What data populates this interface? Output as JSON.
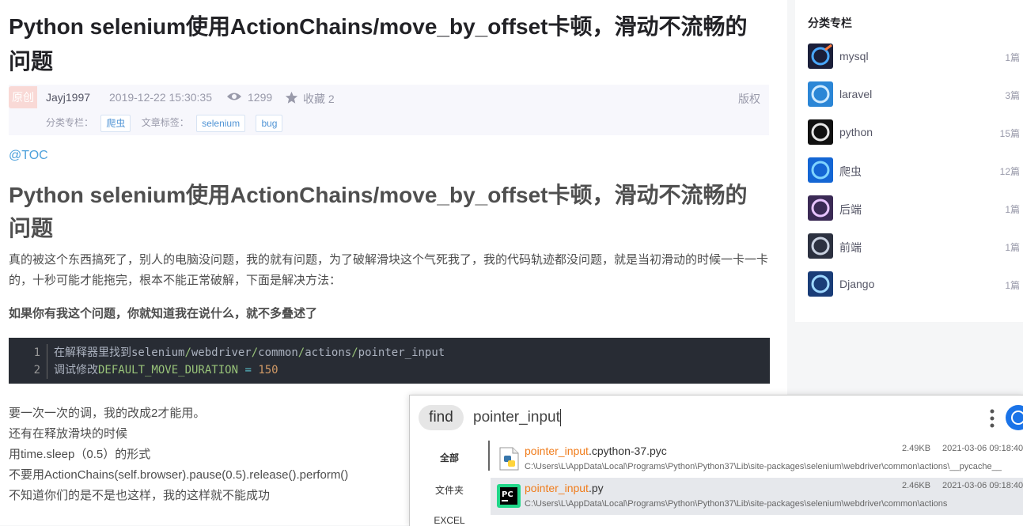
{
  "article": {
    "title": "Python selenium使用ActionChains/move_by_offset卡顿，滑动不流畅的问题",
    "badge": "原创",
    "author": "Jayj1997",
    "date": "2019-12-22 15:30:35",
    "views": "1299",
    "collect": "收藏 2",
    "copyright": "版权",
    "category_label": "分类专栏：",
    "category_tag": "爬虫",
    "tags_label": "文章标签：",
    "tags": [
      "selenium",
      "bug"
    ],
    "toc": "@TOC",
    "heading": "Python selenium使用ActionChains/move_by_offset卡顿，滑动不流畅的问题",
    "paragraph": "真的被这个东西搞死了，别人的电脑没问题，我的就有问题，为了破解滑块这个气死我了，我的代码轨迹都没问题，就是当初滑动的时候一卡一卡的，十秒可能才能拖完，根本不能正常破解，下面是解决方法：",
    "strong": "如果你有我这个问题，你就知道我在说什么，就不多叠述了",
    "code": {
      "line1_num": "1",
      "line1_a": "在解释器里找到selenium",
      "line1_s1": "/",
      "line1_b": "webdriver",
      "line1_s2": "/",
      "line1_c": "common",
      "line1_s3": "/",
      "line1_d": "actions",
      "line1_s4": "/",
      "line1_e": "pointer_input",
      "line2_num": "2",
      "line2_a": "调试修改",
      "line2_b": "DEFAULT_MOVE_DURATION",
      "line2_op": " = ",
      "line2_num_val": "150"
    },
    "after": [
      "要一次一次的调，我的改成2才能用。",
      "还有在释放滑块的时候",
      "用time.sleep（0.5）的形式",
      "不要用ActionChains(self.browser).pause(0.5).release().perform()",
      "不知道你们的是不是也这样，我的这样就不能成功"
    ]
  },
  "sidebar": {
    "title": "分类专栏",
    "items": [
      {
        "name": "mysql",
        "count": "1篇"
      },
      {
        "name": "laravel",
        "count": "3篇"
      },
      {
        "name": "python",
        "count": "15篇"
      },
      {
        "name": "爬虫",
        "count": "12篇"
      },
      {
        "name": "后端",
        "count": "1篇"
      },
      {
        "name": "前端",
        "count": "1篇"
      },
      {
        "name": "Django",
        "count": "1篇"
      }
    ]
  },
  "finder": {
    "find_label": "find",
    "query": "pointer_input",
    "filters": [
      "全部",
      "文件夹",
      "EXCEL"
    ],
    "results": [
      {
        "name_hl": "pointer_input",
        "name_rest": ".cpython-37.pyc",
        "path": "C:\\Users\\L\\AppData\\Local\\Programs\\Python\\Python37\\Lib\\site-packages\\selenium\\webdriver\\common\\actions\\__pycache__",
        "size": "2.49KB",
        "date": "2021-03-06 09:18:40"
      },
      {
        "name_hl": "pointer_input",
        "name_rest": ".py",
        "path": "C:\\Users\\L\\AppData\\Local\\Programs\\Python\\Python37\\Lib\\site-packages\\selenium\\webdriver\\common\\actions",
        "size": "2.46KB",
        "date": "2021-03-06 09:18:40"
      }
    ]
  }
}
